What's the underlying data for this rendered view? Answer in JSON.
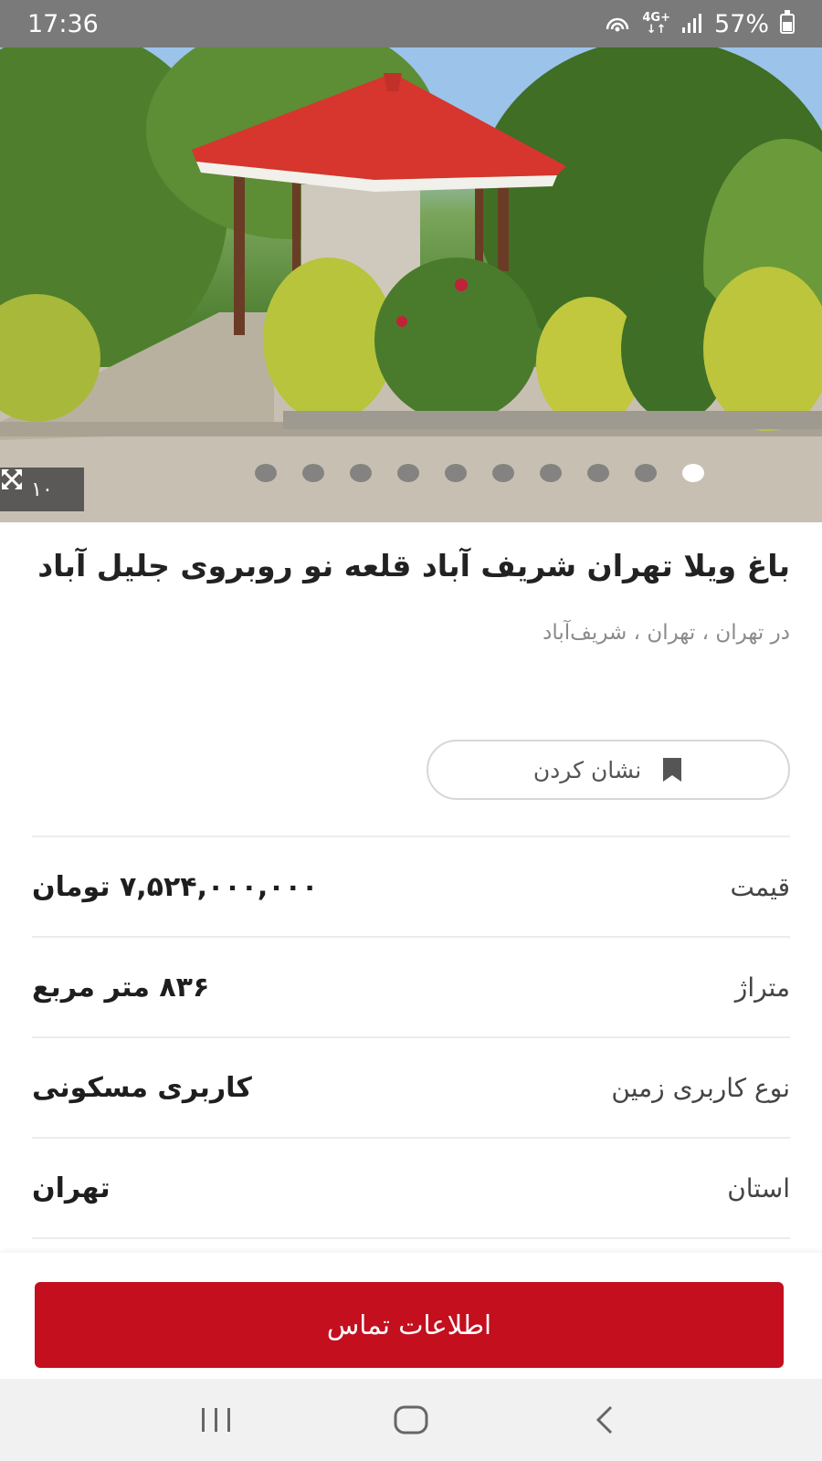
{
  "status_bar": {
    "time": "17:36",
    "network_top": "4G+",
    "battery": "57%"
  },
  "gallery": {
    "photo_count": "۱۰",
    "dots_total": 10,
    "active_dot": 10
  },
  "listing": {
    "title": "باغ ویلا تهران شریف آباد قلعه نو روبروی جلیل آباد",
    "location": "در تهران ، تهران ، شریف‌آباد",
    "bookmark_label": "نشان کردن"
  },
  "details": [
    {
      "label": "قیمت",
      "value": "۷,۵۲۴,۰۰۰,۰۰۰ تومان"
    },
    {
      "label": "متراژ",
      "value": "۸۳۶ متر مربع"
    },
    {
      "label": "نوع کاربری زمین",
      "value": "کاربری مسکونی"
    },
    {
      "label": "استان",
      "value": "تهران"
    }
  ],
  "contact": {
    "label": "اطلاعات تماس"
  },
  "colors": {
    "primary": "#c30f1e",
    "status_bar": "#7a7a7a"
  },
  "icons": {
    "bookmark": "bookmark-icon",
    "expand": "expand-icon",
    "recents": "recents-icon",
    "home": "home-icon",
    "back": "back-icon"
  }
}
